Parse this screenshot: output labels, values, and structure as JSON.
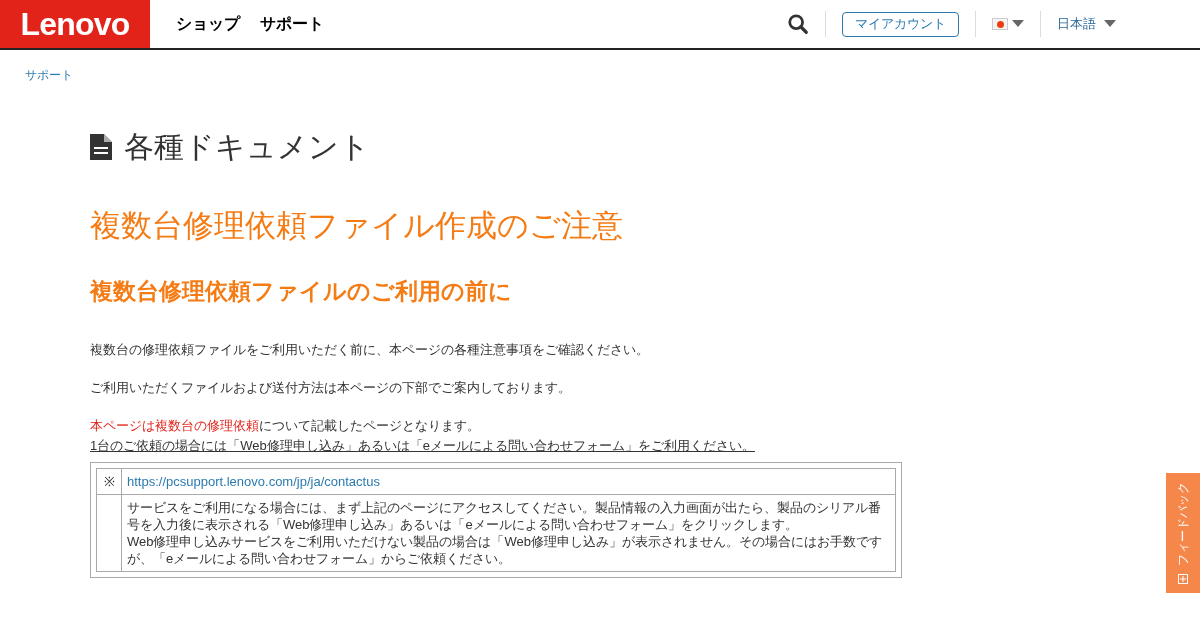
{
  "header": {
    "logo": "Lenovo",
    "nav": [
      "ショップ",
      "サポート"
    ],
    "account_button": "マイアカウント",
    "language": "日本語"
  },
  "breadcrumb": "サポート",
  "page_title": "各種ドキュメント",
  "heading": "複数台修理依頼ファイル作成のご注意",
  "subheading": "複数台修理依頼ファイルのご利用の前に",
  "paragraphs": [
    "複数台の修理依頼ファイルをご利用いただく前に、本ページの各種注意事項をご確認ください。",
    "ご利用いただくファイルおよび送付方法は本ページの下部でご案内しております。"
  ],
  "notice": {
    "highlight": "本ページは複数台の修理依頼",
    "rest": "について記載したページとなります。"
  },
  "underlined_note": "1台のご依頼の場合には「Web修理申し込み」あるいは「eメールによる問い合わせフォーム」をご利用ください。",
  "table": {
    "rows": [
      {
        "mark": "※",
        "link": "https://pcsupport.lenovo.com/jp/ja/contactus"
      },
      {
        "lines": [
          "サービスをご利用になる場合には、まず上記のページにアクセスしてください。製品情報の入力画面が出たら、製品のシリアル番号を入力後に表示される「Web修理申し込み」あるいは「eメールによる問い合わせフォーム」をクリックします。",
          "Web修理申し込みサービスをご利用いただけない製品の場合は「Web修理申し込み」が表示されません。その場合にはお手数ですが、「eメールによる問い合わせフォーム」からご依頼ください。"
        ]
      }
    ]
  },
  "feedback_tab": "フィードバック"
}
